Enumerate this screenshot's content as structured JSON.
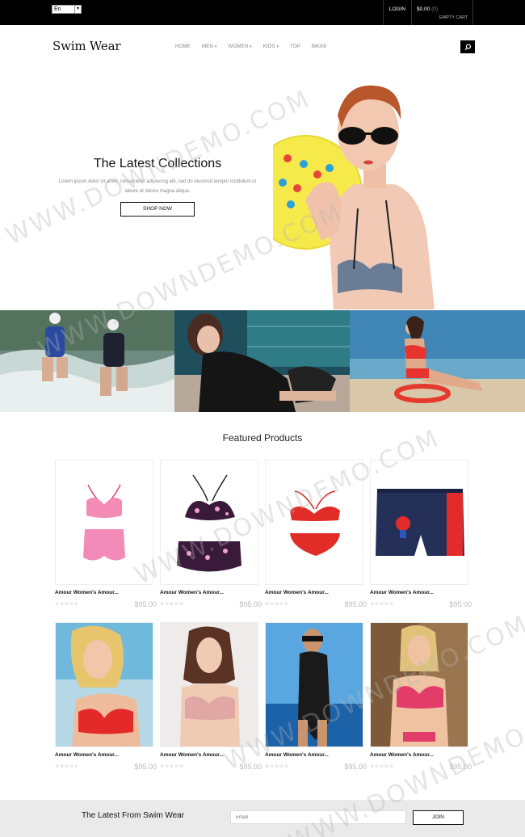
{
  "topbar": {
    "language": "En",
    "login": "LOGIN",
    "cart_total": "$0.00",
    "cart_count": "(0)",
    "cart_status": "EMPTY CART"
  },
  "header": {
    "logo": "Swim Wear",
    "nav": [
      {
        "label": "HOME",
        "dropdown": false
      },
      {
        "label": "MEN",
        "dropdown": true
      },
      {
        "label": "WOMEN",
        "dropdown": true
      },
      {
        "label": "KIDS",
        "dropdown": true
      },
      {
        "label": "TOP",
        "dropdown": false
      },
      {
        "label": "BIKINI",
        "dropdown": false
      }
    ],
    "search_icon": "search-icon"
  },
  "hero": {
    "title": "The Latest Collections",
    "text": "Lorem ipsum dolor sit amet, consectetur adipiscing elit, sed do eiusmod tempor incididunt ut labore et dolore magna aliqua.",
    "button": "SHOP NOW"
  },
  "featured": {
    "title": "Featured Products",
    "products": [
      {
        "name": "Amour Women's Amour...",
        "price": "$95.00",
        "rating": "☆☆☆☆☆"
      },
      {
        "name": "Amour Women's Amour...",
        "price": "$95.00",
        "rating": "☆☆☆☆☆"
      },
      {
        "name": "Amour Women's Amour...",
        "price": "$95.00",
        "rating": "☆☆☆☆☆"
      },
      {
        "name": "Amour Women's Amour...",
        "price": "$95.00",
        "rating": "☆☆☆☆☆"
      },
      {
        "name": "Amour Women's Amour...",
        "price": "$95.00",
        "rating": "☆☆☆☆☆"
      },
      {
        "name": "Amour Women's Amour...",
        "price": "$95.00",
        "rating": "☆☆☆☆☆"
      },
      {
        "name": "Amour Women's Amour...",
        "price": "$95.00",
        "rating": "☆☆☆☆☆"
      },
      {
        "name": "Amour Women's Amour...",
        "price": "$95.00",
        "rating": "☆☆☆☆☆"
      }
    ]
  },
  "newsletter": {
    "title": "The Latest From Swim Wear",
    "placeholder": "Email",
    "button": "JOIN"
  },
  "watermark": "WWW.DOWNDEMO.COM",
  "colors": {
    "topbar": "#000000",
    "newsletter_bg": "#eaeaea",
    "price": "#bbbbbb"
  }
}
